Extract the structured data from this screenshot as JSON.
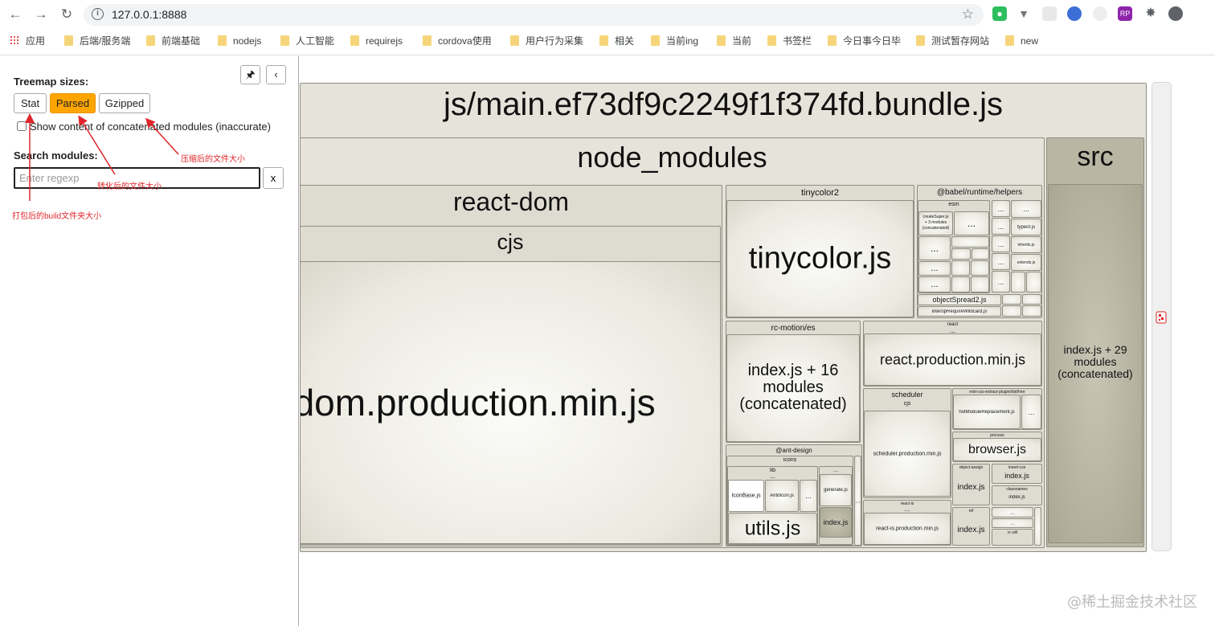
{
  "browser": {
    "url": "127.0.0.1:8888",
    "bookmarks": [
      "应用",
      "后端/服务端",
      "前端基础",
      "nodejs",
      "人工智能",
      "requirejs",
      "cordova使用",
      "用户行为采集",
      "相关",
      "当前ing",
      "当前",
      "书签栏",
      "今日事今日毕",
      "测试暂存网站",
      "new"
    ]
  },
  "sidebar": {
    "sizes_title": "Treemap sizes:",
    "size_buttons": [
      "Stat",
      "Parsed",
      "Gzipped"
    ],
    "active_size": "Parsed",
    "concat_label": "Show content of concatenated modules (inaccurate)",
    "search_title": "Search modules:",
    "search_placeholder": "Enter regexp",
    "clear_label": "x",
    "pin_icon": "pin-icon",
    "collapse_icon": "chevron-left-icon"
  },
  "annotations": {
    "gzipped": "压缩后的文件大小",
    "parsed": "转化后的文件大小",
    "stat": "打包后的build文件夹大小"
  },
  "treemap": {
    "bundle": "js/main.ef73df9c2249f1f374fd.bundle.js",
    "node_modules": "node_modules",
    "src": "src",
    "src_index": [
      "index.js + 29",
      "modules",
      "(concatenated)"
    ],
    "react_dom": "react-dom",
    "cjs": "cjs",
    "react_dom_prod": "react-dom.production.min.js",
    "tinycolor2": "tinycolor2",
    "tinycolor_js": "tinycolor.js",
    "babel_helpers": "@babel/runtime/helpers",
    "esm": "esm",
    "create_super": [
      "createSuper.js",
      "+ 3 modules",
      "(concatenated)"
    ],
    "typeof": "typeof.js",
    "inherits": "inherits.js",
    "extends": "extends.js",
    "object_spread": "objectSpread2.js",
    "interop": "interopRequireWildcard.js",
    "ellipsis": "...",
    "rc_motion": "rc-motion/es",
    "rc_motion_index": [
      "index.js + 16",
      "modules",
      "(concatenated)"
    ],
    "react": "react",
    "react_prod": "react.production.min.js",
    "scheduler": "scheduler",
    "scheduler_prod": "scheduler.production.min.js",
    "mini_css": "mini-css-extract-plugin/dist/hmr",
    "hot_module": "hotModuleReplacement.js",
    "process": "process",
    "browser_js": "browser.js",
    "object_assign": "object-assign",
    "insert_css": "insert-css",
    "classnames": "classnames",
    "index_js": "index.js",
    "ant_design": "@ant-design",
    "icons": "icons",
    "lib": "lib",
    "icon_base": "IconBase.js",
    "antd_icon": "AntdIcon.js",
    "generate": "generate.js",
    "utils_js": "utils.js",
    "react_is": "react-is",
    "react_is_prod": "react-is.production.min.js",
    "rc_util": "rc-util",
    "ref": "ref"
  },
  "watermark": "@稀土掘金技术社区"
}
